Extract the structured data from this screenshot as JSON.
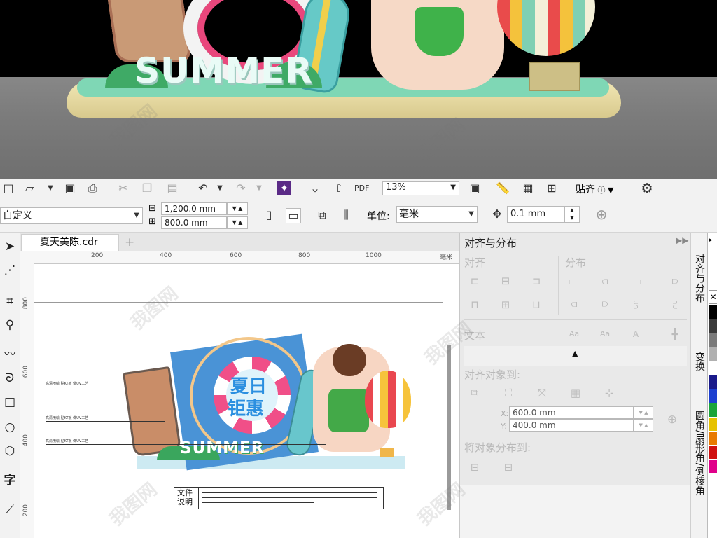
{
  "render": {
    "brand_text": "SUMMER"
  },
  "toolbar_top": {
    "zoom": "13%",
    "snap_label": "贴齐"
  },
  "property_bar": {
    "page_preset": "自定义",
    "width": "1,200.0 mm",
    "height": "800.0 mm",
    "unit_label": "单位:",
    "unit_value": "毫米",
    "nudge": "0.1 mm"
  },
  "document": {
    "tab_name": "夏天美陈.cdr",
    "ruler_unit": "毫米",
    "hruler_ticks": [
      "200",
      "400",
      "600",
      "800",
      "1000"
    ],
    "vruler_ticks": [
      "800",
      "600",
      "400",
      "200"
    ],
    "artwork": {
      "title_line1": "夏日",
      "title_line2": "钜惠",
      "summer_text": "SUMMER",
      "notes": [
        "高清喷绘 贴KT板 做UV工艺",
        "高清喷绘 贴KT板 做UV工艺",
        "高清喷绘 贴KT板 做UV工艺"
      ],
      "legend_label_1": "文件",
      "legend_label_2": "说明"
    }
  },
  "docker": {
    "title": "对齐与分布",
    "align_section": "对齐",
    "distribute_section": "分布",
    "text_section": "文本",
    "align_to_section": "对齐对象到:",
    "x_label": "X:",
    "x_value": "600.0 mm",
    "y_label": "Y:",
    "y_value": "400.0 mm",
    "distribute_to_section": "将对象分布到:"
  },
  "side_tabs": [
    "对齐与分布",
    "变换",
    "圆角/扇形角/倒棱角"
  ],
  "palette": [
    "#000000",
    "#3a3a3a",
    "#7a7a7a",
    "#b0b0b0",
    "#ffffff",
    "#1a1a8a",
    "#1c3fd0",
    "#1aa43a",
    "#e6c200",
    "#e87a00",
    "#d01010",
    "#e0008a"
  ],
  "watermark": "我图网"
}
